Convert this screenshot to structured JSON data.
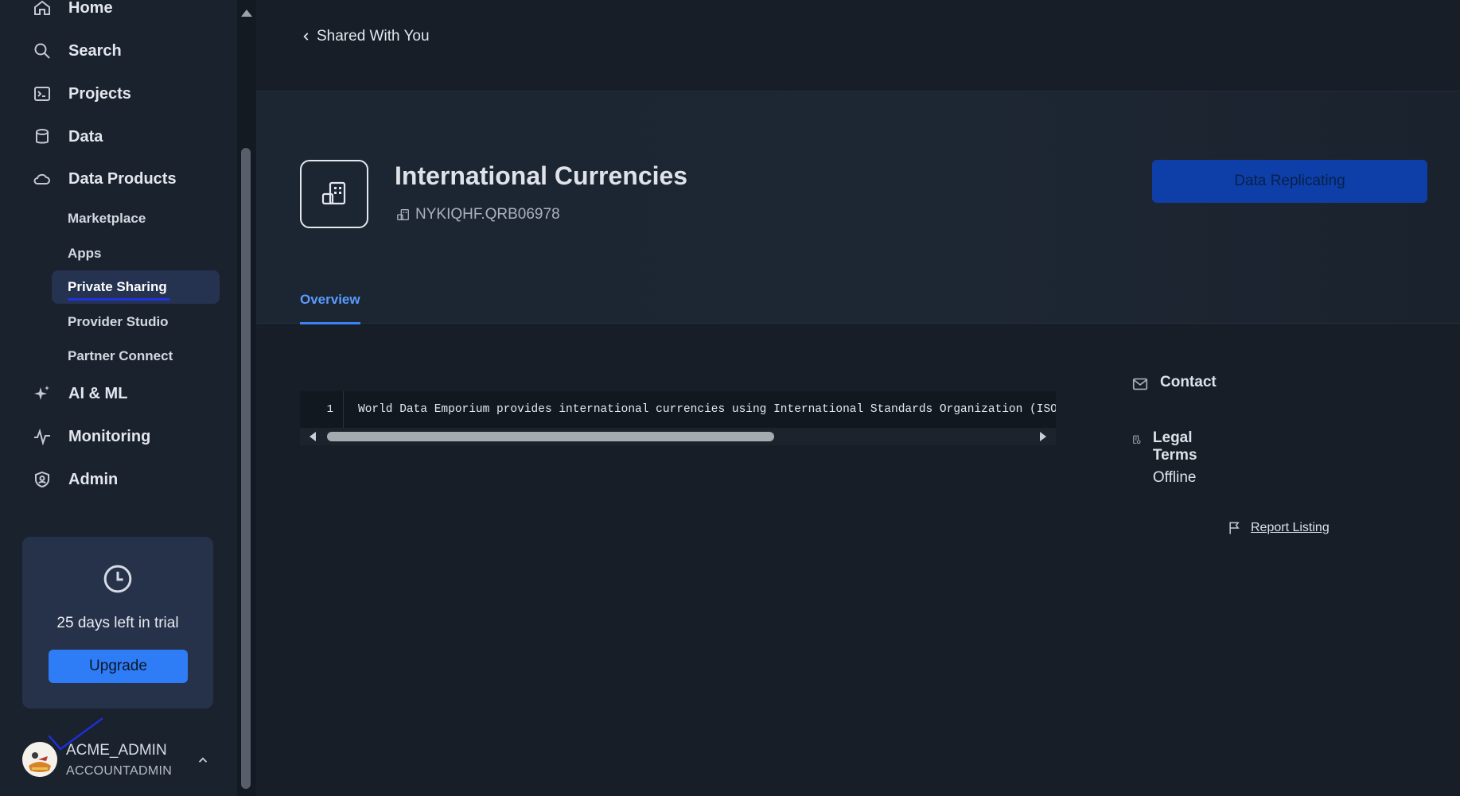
{
  "sidebar": {
    "nav": {
      "home": "Home",
      "search": "Search",
      "projects": "Projects",
      "data": "Data",
      "data_products": "Data Products",
      "ai_ml": "AI & ML",
      "monitoring": "Monitoring",
      "admin": "Admin"
    },
    "sub_items": {
      "marketplace": "Marketplace",
      "apps": "Apps",
      "private_sharing": "Private Sharing",
      "provider_studio": "Provider Studio",
      "partner_connect": "Partner Connect"
    },
    "trial": {
      "text": "25 days left in trial",
      "upgrade_label": "Upgrade"
    },
    "user": {
      "name": "ACME_ADMIN",
      "role": "ACCOUNTADMIN"
    }
  },
  "main": {
    "back_label": "Shared With You",
    "title": "International Currencies",
    "listing_id": "NYKIQHF.QRB06978",
    "primary_button": "Data Replicating",
    "tabs": [
      "Overview"
    ],
    "code": {
      "line_number": "1",
      "text": "World Data Emporium provides international currencies using International Standards Organization (ISO) codes"
    },
    "contact_label": "Contact",
    "legal_terms_label": "Legal Terms",
    "legal_terms_value": "Offline",
    "report_label": "Report Listing"
  },
  "colors": {
    "accent": "#3b82f6",
    "upgrade": "#2f7df6",
    "replicating": "#0e3fa8",
    "active_nav": "#253351"
  }
}
